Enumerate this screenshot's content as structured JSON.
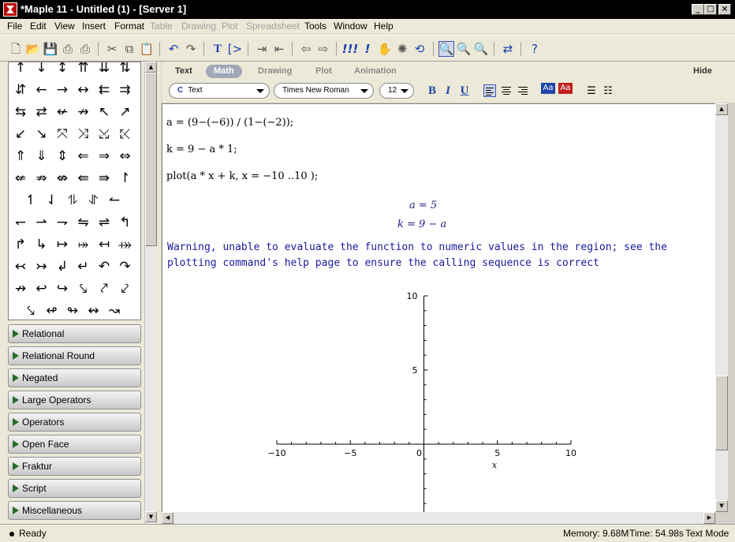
{
  "window": {
    "title": "*Maple 11 - Untitled (1) - [Server 1]"
  },
  "menu": [
    "File",
    "Edit",
    "View",
    "Insert",
    "Format",
    "Table",
    "Drawing",
    "Plot",
    "Spreadsheet",
    "Tools",
    "Window",
    "Help"
  ],
  "menu_disabled": [
    "Table",
    "Drawing",
    "Plot",
    "Spreadsheet"
  ],
  "toolbar": {
    "icons": [
      "new-icon",
      "open-icon",
      "save-icon",
      "print-icon",
      "print-preview-icon",
      "cut-icon",
      "copy-icon",
      "paste-icon",
      "undo-icon",
      "redo-icon",
      "text-mode-icon",
      "math-input-icon",
      "indent-icon",
      "outdent-icon",
      "back-icon",
      "forward-icon",
      "execute-all-icon",
      "execute-icon",
      "stop-icon",
      "debug-icon",
      "restart-icon",
      "zoom-1-icon",
      "zoom-2-icon",
      "zoom-3-icon",
      "toggle-icon",
      "help-icon"
    ]
  },
  "palette": {
    "arrows": [
      [
        "↑",
        "↓",
        "↕",
        "⇈",
        "⇊",
        "⇅"
      ],
      [
        "⇵",
        "←",
        "→",
        "↔",
        "⇇",
        "⇉"
      ],
      [
        "⇆",
        "⇄",
        "↚",
        "↛",
        "↖",
        "↗"
      ],
      [
        "↙",
        "↘",
        "⤧",
        "⤨",
        "⤩",
        "⤪"
      ],
      [
        "⇑",
        "⇓",
        "⇕",
        "⇐",
        "⇒",
        "⇔"
      ],
      [
        "⇍",
        "⇏",
        "⇎",
        "⇚",
        "⇛",
        "↾"
      ],
      [
        "↿",
        "⇃",
        "⥮",
        "⥯",
        "↼"
      ],
      [
        "↽",
        "⇀",
        "⇁",
        "⇋",
        "⇌",
        "↰"
      ],
      [
        "↱",
        "↳",
        "↦",
        "⤅",
        "↤",
        "⤀"
      ],
      [
        "↢",
        "↣",
        "↲",
        "↵",
        "↶",
        "↷"
      ],
      [
        "↛",
        "↩",
        "↪",
        "⤥",
        "⤤",
        "⤦"
      ],
      [
        "⤥",
        "↫",
        "↬",
        "↭",
        "↝"
      ]
    ],
    "sections": [
      "Relational",
      "Relational Round",
      "Negated",
      "Large Operators",
      "Operators",
      "Open Face",
      "Fraktur",
      "Script",
      "Miscellaneous"
    ]
  },
  "context": {
    "tabs": [
      "Text",
      "Math",
      "Drawing",
      "Plot",
      "Animation"
    ],
    "selected_tab": "Math",
    "hide_label": "Hide",
    "style_value": "Text",
    "style_prefix": "C",
    "font_value": "Times New Roman",
    "size_value": "12",
    "bold": "B",
    "italic": "I",
    "underline": "U"
  },
  "document": {
    "inputs": [
      "a = (9−(−6)) / (1−(−2));",
      "k = 9 − a * 1;",
      "plot(a * x + k, x = −10 ..10 );"
    ],
    "outputs": [
      "a = 5",
      "k = 9 − a"
    ],
    "warning": "Warning, unable to evaluate the function to numeric values in the region; see the plotting command's help page to ensure the calling sequence is correct"
  },
  "chart_data": {
    "type": "line",
    "series": [],
    "xlim": [
      -10,
      10
    ],
    "ylim": [
      -10,
      10
    ],
    "xticks": [
      "−10",
      "−5",
      "0",
      "5",
      "10"
    ],
    "yticks": [
      "10",
      "5"
    ],
    "xlabel": "x",
    "ylabel": ""
  },
  "status": {
    "ready": "Ready",
    "memory": "Memory: 9.68M",
    "time": "Time: 54.98s",
    "mode": "Text Mode"
  },
  "colors": {
    "title_bg": "#000000",
    "output_blue": "#1a1a9a",
    "panel": "#ece9d8"
  }
}
